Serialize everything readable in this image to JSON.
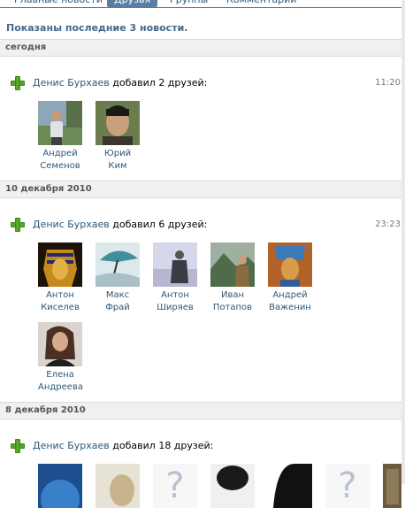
{
  "tabs": [
    {
      "label": "Главные новости"
    },
    {
      "label": "Друзья"
    },
    {
      "label": "Группы"
    },
    {
      "label": "Комментарии"
    }
  ],
  "summary": "Показаны последние 3 новости.",
  "days": [
    {
      "label": "сегодня"
    },
    {
      "label": "10 декабря 2010"
    },
    {
      "label": "8 декабря 2010"
    }
  ],
  "news": [
    {
      "who": "Денис Бурхаев",
      "action": "добавил 2 друзей:",
      "time": "11:20",
      "friends": [
        {
          "first": "Андрей",
          "last": "Семенов"
        },
        {
          "first": "Юрий",
          "last": "Ким"
        }
      ]
    },
    {
      "who": "Денис Бурхаев",
      "action": "добавил 6 друзей:",
      "time": "23:23",
      "friends": [
        {
          "first": "Антон",
          "last": "Киселев"
        },
        {
          "first": "Макс",
          "last": "Фрай"
        },
        {
          "first": "Антон",
          "last": "Ширяев"
        },
        {
          "first": "Иван",
          "last": "Потапов"
        },
        {
          "first": "Андрей",
          "last": "Важенин"
        },
        {
          "first": "Елена",
          "last": "Андреева"
        }
      ]
    },
    {
      "who": "Денис Бурхаев",
      "action": "добавил 18 друзей:",
      "time": ""
    }
  ],
  "colors": {
    "link": "#2b587a",
    "tab_active": "#597da3",
    "plus": "#5aa32d"
  }
}
